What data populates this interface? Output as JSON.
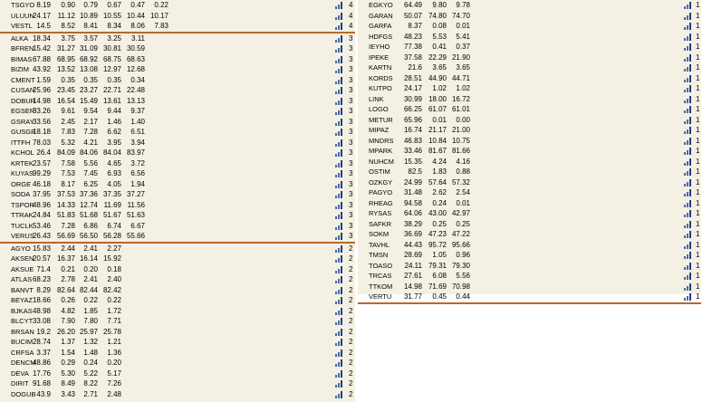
{
  "left_table": {
    "rows": [
      {
        "symbol": "TSGYO",
        "vals": [
          "8.19",
          "0.90",
          "0.79",
          "0.67",
          "0.47",
          "0.22"
        ],
        "group": "4"
      },
      {
        "symbol": "ULUUN",
        "vals": [
          "24.17",
          "11.12",
          "10.89",
          "10.55",
          "10.44",
          "10.17"
        ],
        "group": "4"
      },
      {
        "symbol": "VESTL",
        "vals": [
          "14.5",
          "8.52",
          "8.41",
          "8.34",
          "8.06",
          "7.83"
        ],
        "group": "4",
        "sep": true
      },
      {
        "symbol": "ALKA",
        "vals": [
          "18.34",
          "3.75",
          "3.57",
          "3.25",
          "3.11"
        ],
        "group": "3"
      },
      {
        "symbol": "BFREN",
        "vals": [
          "15.42",
          "31.27",
          "31.09",
          "30.81",
          "30.59"
        ],
        "group": "3"
      },
      {
        "symbol": "BIMAS",
        "vals": [
          "67.88",
          "68.95",
          "68.92",
          "68.75",
          "68.63"
        ],
        "group": "3"
      },
      {
        "symbol": "BIZIM",
        "vals": [
          "43.92",
          "13.52",
          "13.08",
          "12.97",
          "12.68"
        ],
        "group": "3"
      },
      {
        "symbol": "CMENT",
        "vals": [
          "1.59",
          "0.35",
          "0.35",
          "0.35",
          "0.34"
        ],
        "group": "3"
      },
      {
        "symbol": "CUSAN",
        "vals": [
          "25.96",
          "23.45",
          "23.27",
          "22.71",
          "22.48"
        ],
        "group": "3"
      },
      {
        "symbol": "DOBUR",
        "vals": [
          "14.98",
          "16.54",
          "15.49",
          "13.61",
          "13.13"
        ],
        "group": "3"
      },
      {
        "symbol": "EGSER",
        "vals": [
          "33.26",
          "9.61",
          "9.54",
          "9.44",
          "9.37"
        ],
        "group": "3"
      },
      {
        "symbol": "GSRAY",
        "vals": [
          "33.56",
          "2.45",
          "2.17",
          "1.46",
          "1.40"
        ],
        "group": "3"
      },
      {
        "symbol": "GUSGR",
        "vals": [
          "18.18",
          "7.83",
          "7.28",
          "6.62",
          "6.51"
        ],
        "group": "3"
      },
      {
        "symbol": "ITTFH",
        "vals": [
          "78.03",
          "5.32",
          "4.21",
          "3.95",
          "3.94"
        ],
        "group": "3"
      },
      {
        "symbol": "KCHOL",
        "vals": [
          "26.4",
          "84.09",
          "84.06",
          "84.04",
          "83.97"
        ],
        "group": "3"
      },
      {
        "symbol": "KRTEK",
        "vals": [
          "23.57",
          "7.58",
          "5.56",
          "4.65",
          "3.72"
        ],
        "group": "3"
      },
      {
        "symbol": "KUYAS",
        "vals": [
          "99.29",
          "7.53",
          "7.45",
          "6.93",
          "6.56"
        ],
        "group": "3"
      },
      {
        "symbol": "ORGE",
        "vals": [
          "46.18",
          "8.17",
          "6.25",
          "4.05",
          "1.94"
        ],
        "group": "3"
      },
      {
        "symbol": "SODA",
        "vals": [
          "37.95",
          "37.53",
          "37.36",
          "37.35",
          "37.27"
        ],
        "group": "3"
      },
      {
        "symbol": "TSPOR",
        "vals": [
          "48.96",
          "14.33",
          "12.74",
          "11.69",
          "11.56"
        ],
        "group": "3"
      },
      {
        "symbol": "TTRAK",
        "vals": [
          "24.84",
          "51.83",
          "51.68",
          "51.67",
          "51.63"
        ],
        "group": "3"
      },
      {
        "symbol": "TUCLK",
        "vals": [
          "53.46",
          "7.28",
          "6.86",
          "6.74",
          "6.67"
        ],
        "group": "3"
      },
      {
        "symbol": "VERUS",
        "vals": [
          "26.43",
          "56.69",
          "56.50",
          "56.28",
          "55.66"
        ],
        "group": "3",
        "sep": true
      },
      {
        "symbol": "AGYO",
        "vals": [
          "15.83",
          "2.44",
          "2.41",
          "2.27"
        ],
        "group": "2"
      },
      {
        "symbol": "AKSEN",
        "vals": [
          "20.57",
          "16.37",
          "16.14",
          "15.92"
        ],
        "group": "2"
      },
      {
        "symbol": "AKSUE",
        "vals": [
          "71.4",
          "0.21",
          "0.20",
          "0.18"
        ],
        "group": "2"
      },
      {
        "symbol": "ATLAS",
        "vals": [
          "68.23",
          "2.78",
          "2.41",
          "2.40"
        ],
        "group": "2"
      },
      {
        "symbol": "BANVT",
        "vals": [
          "8.29",
          "82.64",
          "82.44",
          "82.42"
        ],
        "group": "2"
      },
      {
        "symbol": "BEYAZ",
        "vals": [
          "18.66",
          "0.26",
          "0.22",
          "0.22"
        ],
        "group": "2"
      },
      {
        "symbol": "BJKAS",
        "vals": [
          "48.98",
          "4.82",
          "1.85",
          "1.72"
        ],
        "group": "2"
      },
      {
        "symbol": "BLCYT",
        "vals": [
          "33.08",
          "7.90",
          "7.80",
          "7.71"
        ],
        "group": "2"
      },
      {
        "symbol": "BRSAN",
        "vals": [
          "19.2",
          "26.20",
          "25.97",
          "25.78"
        ],
        "group": "2"
      },
      {
        "symbol": "BUCIM",
        "vals": [
          "28.74",
          "1.37",
          "1.32",
          "1.21"
        ],
        "group": "2"
      },
      {
        "symbol": "CRFSA",
        "vals": [
          "3.37",
          "1.54",
          "1.48",
          "1.36"
        ],
        "group": "2"
      },
      {
        "symbol": "DENCM",
        "vals": [
          "48.86",
          "0.29",
          "0.24",
          "0.20"
        ],
        "group": "2"
      },
      {
        "symbol": "DEVA",
        "vals": [
          "17.76",
          "5.30",
          "5.22",
          "5.17"
        ],
        "group": "2"
      },
      {
        "symbol": "DIRIT",
        "vals": [
          "91.68",
          "8.49",
          "8.22",
          "7.26"
        ],
        "group": "2"
      },
      {
        "symbol": "DOGUB",
        "vals": [
          "43.9",
          "3.43",
          "2.71",
          "2.48"
        ],
        "group": "2"
      }
    ]
  },
  "right_table": {
    "rows": [
      {
        "symbol": "EGKYO",
        "vals": [
          "64.49",
          "9.80",
          "9.78"
        ],
        "group": "1"
      },
      {
        "symbol": "GARAN",
        "vals": [
          "50.07",
          "74.80",
          "74.70"
        ],
        "group": "1"
      },
      {
        "symbol": "GARFA",
        "vals": [
          "8.37",
          "0.08",
          "0.01"
        ],
        "group": "1"
      },
      {
        "symbol": "HDFGS",
        "vals": [
          "48.23",
          "5.53",
          "5.41"
        ],
        "group": "1"
      },
      {
        "symbol": "IEYHO",
        "vals": [
          "77.38",
          "0.41",
          "0.37"
        ],
        "group": "1"
      },
      {
        "symbol": "IPEKE",
        "vals": [
          "37.58",
          "22.29",
          "21.90"
        ],
        "group": "1"
      },
      {
        "symbol": "KARTN",
        "vals": [
          "21.6",
          "3.65",
          "3.65"
        ],
        "group": "1"
      },
      {
        "symbol": "KORDS",
        "vals": [
          "28.51",
          "44.90",
          "44.71"
        ],
        "group": "1"
      },
      {
        "symbol": "KUTPO",
        "vals": [
          "24.17",
          "1.02",
          "1.02"
        ],
        "group": "1"
      },
      {
        "symbol": "LINK",
        "vals": [
          "30.99",
          "18.00",
          "16.72"
        ],
        "group": "1"
      },
      {
        "symbol": "LOGO",
        "vals": [
          "66.25",
          "61.07",
          "61.01"
        ],
        "group": "1"
      },
      {
        "symbol": "METUR",
        "vals": [
          "65.96",
          "0.01",
          "0.00"
        ],
        "group": "1"
      },
      {
        "symbol": "MIPAZ",
        "vals": [
          "16.74",
          "21.17",
          "21.00"
        ],
        "group": "1"
      },
      {
        "symbol": "MNDRS",
        "vals": [
          "46.83",
          "10.84",
          "10.75"
        ],
        "group": "1"
      },
      {
        "symbol": "MPARK",
        "vals": [
          "33.46",
          "81.67",
          "81.66"
        ],
        "group": "1"
      },
      {
        "symbol": "NUHCM",
        "vals": [
          "15.35",
          "4.24",
          "4.16"
        ],
        "group": "1"
      },
      {
        "symbol": "OSTIM",
        "vals": [
          "82.5",
          "1.83",
          "0.88"
        ],
        "group": "1"
      },
      {
        "symbol": "OZKGY",
        "vals": [
          "24.99",
          "57.64",
          "57.32"
        ],
        "group": "1"
      },
      {
        "symbol": "PAGYO",
        "vals": [
          "31.48",
          "2.62",
          "2.54"
        ],
        "group": "1"
      },
      {
        "symbol": "RHEAG",
        "vals": [
          "94.58",
          "0.24",
          "0.01"
        ],
        "group": "1"
      },
      {
        "symbol": "RYSAS",
        "vals": [
          "64.06",
          "43.00",
          "42.97"
        ],
        "group": "1"
      },
      {
        "symbol": "SAFKR",
        "vals": [
          "38.29",
          "0.25",
          "0.25"
        ],
        "group": "1"
      },
      {
        "symbol": "SOKM",
        "vals": [
          "36.69",
          "47.23",
          "47.22"
        ],
        "group": "1"
      },
      {
        "symbol": "TAVHL",
        "vals": [
          "44.43",
          "95.72",
          "95.66"
        ],
        "group": "1"
      },
      {
        "symbol": "TMSN",
        "vals": [
          "28.69",
          "1.05",
          "0.96"
        ],
        "group": "1"
      },
      {
        "symbol": "TOASO",
        "vals": [
          "24.11",
          "79.31",
          "79.30"
        ],
        "group": "1"
      },
      {
        "symbol": "TRCAS",
        "vals": [
          "27.61",
          "6.08",
          "5.56"
        ],
        "group": "1"
      },
      {
        "symbol": "TTKOM",
        "vals": [
          "14.98",
          "71.69",
          "70.98"
        ],
        "group": "1"
      },
      {
        "symbol": "VERTU",
        "vals": [
          "31.77",
          "0.45",
          "0.44"
        ],
        "group": "1",
        "sep": true
      }
    ]
  },
  "colors": {
    "panel_bg": "#f4f1e4",
    "separator": "#b8682a",
    "bar_icon": "#4b6aa6"
  },
  "icons": {
    "row_indicator": "signal-bars-icon"
  }
}
